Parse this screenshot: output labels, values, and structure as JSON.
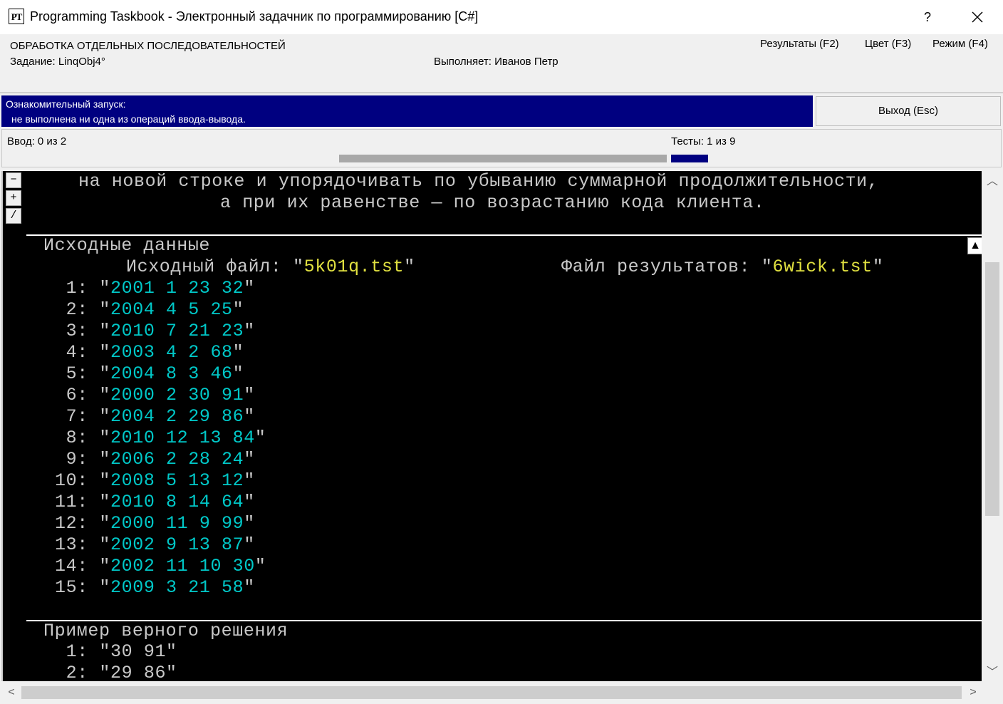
{
  "window": {
    "icon_text": "PT",
    "title": "Programming Taskbook - Электронный задачник по программированию [C#]",
    "help_label": "?"
  },
  "header": {
    "section_title": "ОБРАБОТКА ОТДЕЛЬНЫХ ПОСЛЕДОВАТЕЛЬНОСТЕЙ",
    "task_label": "Задание: LinqObj4°",
    "student_label": "Выполняет: Иванов Петр",
    "menu": [
      {
        "label": "Результаты (F2)"
      },
      {
        "label": "Цвет (F3)"
      },
      {
        "label": "Режим (F4)"
      }
    ]
  },
  "status": {
    "line1": "Ознакомительный запуск:",
    "line2": " не выполнена ни одна из операций ввода-вывода.",
    "exit_label": "Выход (Esc)",
    "panel_color": "#000080"
  },
  "progress": {
    "input_label": "Ввод:  0 из 2",
    "input_fraction": 0.0,
    "tests_label": "Тесты:  1 из 9",
    "tests_fraction": 1.0
  },
  "console": {
    "side_buttons": [
      "−",
      "+",
      "/"
    ],
    "description": [
      "на новой строке и упорядочивать по убыванию суммарной продолжительности,",
      "а при их равенстве — по возрастанию кода клиента."
    ],
    "input_section": {
      "title": "Исходные данные",
      "file_label": "Исходный файл: ",
      "file_name": "5k01q.tst",
      "result_label": "Файл результатов: ",
      "result_name": "6wick.tst",
      "rows": [
        {
          "n": " 1:",
          "v": "2001 1 23 32"
        },
        {
          "n": " 2:",
          "v": "2004 4 5 25"
        },
        {
          "n": " 3:",
          "v": "2010 7 21 23"
        },
        {
          "n": " 4:",
          "v": "2003 4 2 68"
        },
        {
          "n": " 5:",
          "v": "2004 8 3 46"
        },
        {
          "n": " 6:",
          "v": "2000 2 30 91"
        },
        {
          "n": " 7:",
          "v": "2004 2 29 86"
        },
        {
          "n": " 8:",
          "v": "2010 12 13 84"
        },
        {
          "n": " 9:",
          "v": "2006 2 28 24"
        },
        {
          "n": "10:",
          "v": "2008 5 13 12"
        },
        {
          "n": "11:",
          "v": "2010 8 14 64"
        },
        {
          "n": "12:",
          "v": "2000 11 9 99"
        },
        {
          "n": "13:",
          "v": "2002 9 13 87"
        },
        {
          "n": "14:",
          "v": "2002 11 10 30"
        },
        {
          "n": "15:",
          "v": "2009 3 21 58"
        }
      ]
    },
    "example_section": {
      "title": "Пример верного решения",
      "rows": [
        {
          "n": " 1:",
          "v": "30 91"
        },
        {
          "n": " 2:",
          "v": "29 86"
        }
      ]
    },
    "value_color": "#00c8c8",
    "filename_color": "#e0e040"
  }
}
